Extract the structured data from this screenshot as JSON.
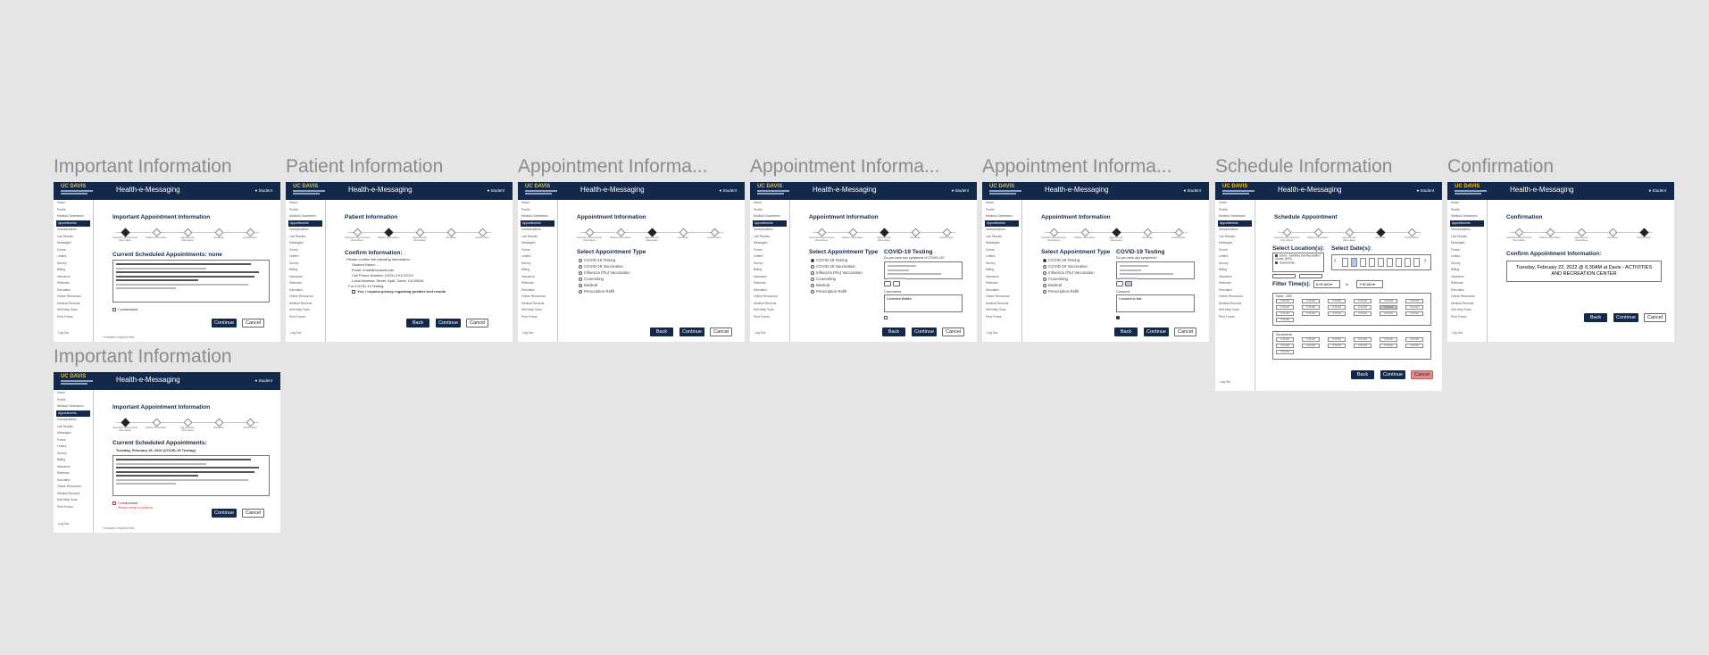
{
  "app": {
    "title": "Health-e-Messaging",
    "user_label": "Student",
    "logo_text": "UC DAVIS"
  },
  "steps": [
    "Important Appointment Information",
    "Patient Information",
    "Appointment Information",
    "Schedule",
    "Confirmation"
  ],
  "sidebar_items": [
    "Home",
    "Profile",
    "Medical Clearances",
    "Appointments",
    "Immunizations",
    "Lab Results",
    "Messages",
    "Forms",
    "Letters",
    "Survey",
    "Billing",
    "Insurance",
    "Referrals",
    "Education",
    "Online Resources",
    "Medical Records",
    "Self-Help Tools",
    "Print Forms"
  ],
  "logout_label": "Log Out",
  "frames": {
    "f1": {
      "title": "Important Information",
      "page_title": "Important Appointment Information",
      "section": "Current Scheduled Appointments: none",
      "acknowledge": "I understand",
      "continue": "Continue",
      "cancel": "Cancel",
      "footer": "* Indicates required field"
    },
    "f2": {
      "title": "Patient Information",
      "page_title": "Patient Information",
      "section": "Confirm Information:",
      "intro": "Please confirm the following information:",
      "lines": [
        "Student Name: ...",
        "Email: email@ucdavis.edu",
        "Cell Phone Number: (XXX) XXX-XXXX",
        "Local Address: Street, Apt#, Davis, CA 95616",
        "For COVID-19 Testing:",
        "Yes, I request privacy regarding positive test results"
      ],
      "back": "Back",
      "continue": "Continue",
      "cancel": "Cancel"
    },
    "f3": {
      "title": "Appointment Informa...",
      "page_title": "Appointment Information",
      "section": "Select Appointment Type",
      "types": [
        "COVID-19 Testing",
        "COVID-19 Vaccination",
        "Influenza (Flu) Vaccination",
        "Counseling",
        "Medical",
        "Prescription Refill"
      ],
      "back": "Back",
      "continue": "Continue",
      "cancel": "Cancel"
    },
    "f4": {
      "title": "Appointment Informa...",
      "page_title": "Appointment Information",
      "section": "Select Appointment Type",
      "section2": "COVID-19 Testing",
      "question": "Do you have any symptoms of COVID-19?",
      "comments_label": "Comments",
      "comments_value": "Comment Written",
      "back": "Back",
      "continue": "Continue",
      "cancel": "Cancel"
    },
    "f5": {
      "title": "Appointment Informa...",
      "page_title": "Appointment Information",
      "section": "Select Appointment Type",
      "section2": "COVID-19 Testing",
      "question": "Do you have any symptoms?",
      "consent_label": "Consent",
      "consent_value": "I consent to test",
      "back": "Back",
      "continue": "Continue",
      "cancel": "Cancel"
    },
    "f6": {
      "title": "Schedule Information",
      "page_title": "Schedule Appointment",
      "location_label": "Select Location(s):",
      "locations": [
        "Davis - Activities and Recreation Center (ARC)",
        "Sacramento"
      ],
      "dates_label": "Select Date(s):",
      "time_label": "Filter Time(s):",
      "time_from": "6:00 AM",
      "time_to_word": "to",
      "time_to": "7:00 AM",
      "group1": "Davis - ARC",
      "group2": "Sacramento",
      "slot_time": "6:30 AM",
      "back": "Back",
      "continue": "Continue",
      "cancel": "Cancel"
    },
    "f7": {
      "title": "Confirmation",
      "page_title": "Confirmation",
      "section": "Confirm Appointment Information:",
      "summary": "Tuesday, February 22, 2022 @ 6:30AM at Davis - ACTIVITIES AND RECREATION CENTER",
      "back": "Back",
      "continue": "Continue",
      "cancel": "Cancel"
    },
    "f8": {
      "title": "Important Information",
      "page_title": "Important Appointment Information",
      "section": "Current Scheduled Appointments:",
      "appt": "Tuesday, February 15, 2022 (COVID-19 Testing)",
      "acknowledge": "I understand",
      "error": "Please verify to continue",
      "continue": "Continue",
      "cancel": "Cancel",
      "footer": "* Indicates required field"
    }
  }
}
